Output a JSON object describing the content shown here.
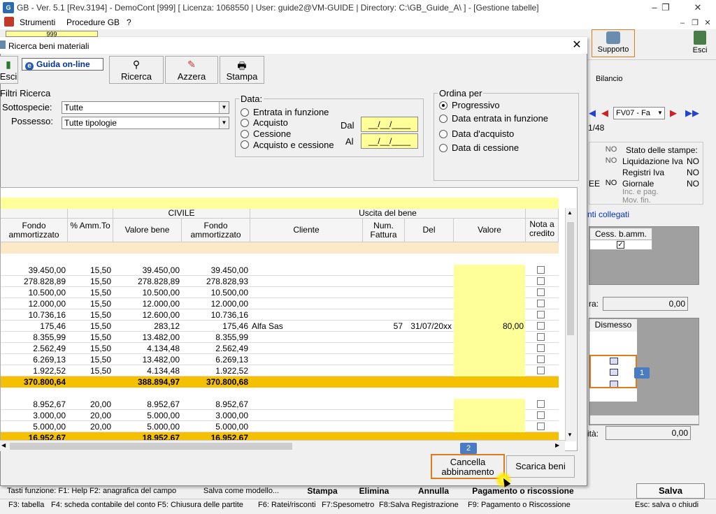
{
  "app": {
    "title": "GB - Ver. 5.1 [Rev.3194] - DemoCont [999]   [ Licenza: 1068550 | User: guide2@VM-GUIDE | Directory: C:\\GB_Guide_A\\ ] - [Gestione tabelle]",
    "menu": [
      "Strumenti",
      "Procedure GB",
      "?"
    ],
    "toolbar_field": "999",
    "supporto_label": "Supporto",
    "esci_label": "Esci"
  },
  "right_panel": {
    "bilancio_tab": "Bilancio",
    "record_select": "FV07 - Fa",
    "page_count": "1/48",
    "stato_title": "Stato delle stampe:",
    "stampe": [
      {
        "label": "Liquidazione Iva",
        "value": "NO"
      },
      {
        "label": "Registri Iva",
        "value": "NO"
      },
      {
        "label": "Giornale",
        "value": "NO"
      },
      {
        "label": "Inc. e pag.",
        "value": ""
      },
      {
        "label": "Mov. fin.",
        "value": ""
      }
    ],
    "left_no": [
      "NO",
      "NO",
      "NO"
    ],
    "ee_label": "EE",
    "collegati": "nti collegati",
    "cess_header": "Cess. b.amm.",
    "ra_label": "ra:",
    "ra_value": "0,00",
    "dismesso_header": "Dismesso",
    "badge1": "1",
    "ita_label": "ità:",
    "ita_value": "0,00"
  },
  "bottom": {
    "buttons": [
      "Tasti funzione: F1: Help  F2: anagrafica del campo",
      "Salva come modello...",
      "Stampa",
      "Elimina",
      "Annulla",
      "Pagamento o riscossione"
    ],
    "salva": "Salva",
    "status": [
      "F3: tabella",
      "F4: scheda contabile del conto",
      "F5: Chiusura delle partite",
      "F6: Ratei/risconti",
      "F7:Spesometro",
      "F8:Salva Registrazione",
      "F9: Pagamento o Riscossione",
      "Esc: salva o chiudi"
    ]
  },
  "dialog": {
    "title": "Ricerca beni materiali",
    "esci_label": "Esci",
    "guida_label": "Guida on-line",
    "ricerca_label": "Ricerca",
    "azzera_label": "Azzera",
    "stampa_label": "Stampa",
    "filtri_title": "Filtri Ricerca",
    "sottospecie_label": "Sottospecie:",
    "sottospecie_value": "Tutte",
    "possesso_label": "Possesso:",
    "possesso_value": "Tutte tipologie",
    "data_title": "Data:",
    "data_options": [
      "Entrata in funzione",
      "Acquisto",
      "Cessione",
      "Acquisto e cessione"
    ],
    "dal_label": "Dal",
    "al_label": "Al",
    "dal_value": "__/__/____",
    "al_value": "__/__/____",
    "ordina_title": "Ordina per",
    "ordina_options": [
      "Progressivo",
      "Data entrata in funzione",
      "Data d'acquisto",
      "Data di cessione"
    ],
    "ordina_selected": 0,
    "civile_group": "CIVILE",
    "uscita_group": "Uscita del bene",
    "columns": [
      "Fondo ammortizzato",
      "% Amm.To",
      "Valore bene",
      "Fondo ammortizzato",
      "Cliente",
      "Num. Fattura",
      "Del",
      "Valore",
      "Nota a credito"
    ],
    "rows_group1": [
      [
        "39.450,00",
        "15,50",
        "39.450,00",
        "39.450,00",
        "",
        "",
        "",
        ""
      ],
      [
        "278.828,89",
        "15,50",
        "278.828,89",
        "278.828,93",
        "",
        "",
        "",
        ""
      ],
      [
        "10.500,00",
        "15,50",
        "10.500,00",
        "10.500,00",
        "",
        "",
        "",
        ""
      ],
      [
        "12.000,00",
        "15,50",
        "12.000,00",
        "12.000,00",
        "",
        "",
        "",
        ""
      ],
      [
        "10.736,16",
        "15,50",
        "12.600,00",
        "10.736,16",
        "",
        "",
        "",
        ""
      ],
      [
        "175,46",
        "15,50",
        "283,12",
        "175,46",
        "Alfa Sas",
        "57",
        "31/07/20xx",
        "80,00"
      ],
      [
        "8.355,99",
        "15,50",
        "13.482,00",
        "8.355,99",
        "",
        "",
        "",
        ""
      ],
      [
        "2.562,49",
        "15,50",
        "4.134,48",
        "2.562,49",
        "",
        "",
        "",
        ""
      ],
      [
        "6.269,13",
        "15,50",
        "13.482,00",
        "6.269,13",
        "",
        "",
        "",
        ""
      ],
      [
        "1.922,52",
        "15,50",
        "4.134,48",
        "1.922,52",
        "",
        "",
        "",
        ""
      ]
    ],
    "total1": [
      "370.800,64",
      "",
      "388.894,97",
      "370.800,68"
    ],
    "rows_group2": [
      [
        "8.952,67",
        "20,00",
        "8.952,67",
        "8.952,67",
        "",
        "",
        "",
        ""
      ],
      [
        "3.000,00",
        "20,00",
        "5.000,00",
        "3.000,00",
        "",
        "",
        "",
        ""
      ],
      [
        "5.000,00",
        "20,00",
        "5.000,00",
        "5.000,00",
        "",
        "",
        "",
        ""
      ]
    ],
    "total2": [
      "16.952,67",
      "",
      "18.952,67",
      "16.952,67"
    ],
    "cancella_label": "Cancella\nabbinamento",
    "scarica_label": "Scarica beni",
    "badge2": "2"
  },
  "colors": {
    "accent_orange": "#e07b1a",
    "badge_blue": "#4a7cc4",
    "yellow": "#ffff99",
    "total": "#f4c000"
  }
}
